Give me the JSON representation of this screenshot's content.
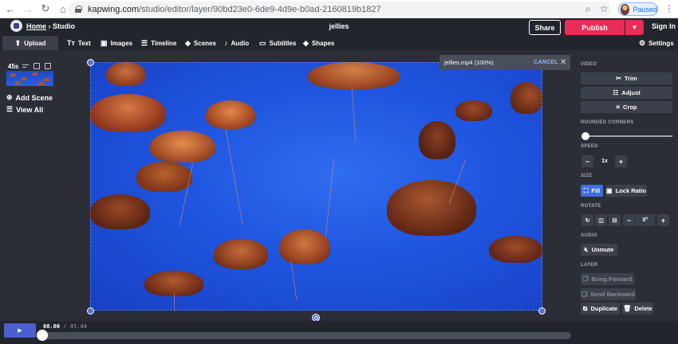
{
  "browser": {
    "url_host": "kapwing.com",
    "url_path": "/studio/editor/layer/90bd23e0-6de9-4d9e-b0ad-2160819b1827",
    "profile_status": "Paused"
  },
  "header": {
    "breadcrumb_home": "Home",
    "breadcrumb_sep": "›",
    "breadcrumb_current": "Studio",
    "project_title": "jellies",
    "share_label": "Share",
    "publish_label": "Publish",
    "signin_label": "Sign In"
  },
  "toolbar": {
    "items": [
      {
        "label": "Upload",
        "icon": "upload-icon"
      },
      {
        "label": "Text",
        "icon": "text-icon"
      },
      {
        "label": "Images",
        "icon": "images-icon"
      },
      {
        "label": "Timeline",
        "icon": "timeline-icon"
      },
      {
        "label": "Scenes",
        "icon": "scenes-icon"
      },
      {
        "label": "Audio",
        "icon": "music-note-icon"
      },
      {
        "label": "Subtitles",
        "icon": "subtitles-icon"
      },
      {
        "label": "Shapes",
        "icon": "shapes-icon"
      }
    ],
    "settings_label": "Settings"
  },
  "scenes": {
    "duration": "45s",
    "add_scene_label": "Add Scene",
    "view_all_label": "View All"
  },
  "toast": {
    "filename": "jellies.mp4 (100%)",
    "cancel_label": "CANCEL"
  },
  "right_panel": {
    "video_heading": "VIDEO",
    "trim_label": "Trim",
    "adjust_label": "Adjust",
    "crop_label": "Crop",
    "rounded_heading": "ROUNDED CORNERS",
    "rounded_value": 0,
    "speed_heading": "SPEED",
    "speed_value": "1x",
    "size_heading": "SIZE",
    "fill_label": "Fill",
    "lock_ratio_label": "Lock Ratio",
    "rotate_heading": "ROTATE",
    "rotate_value": "0°",
    "audio_heading": "AUDIO",
    "unmute_label": "Unmute",
    "layer_heading": "LAYER",
    "bring_forward_label": "Bring Forward",
    "send_backward_label": "Send Backward",
    "duplicate_label": "Duplicate",
    "delete_label": "Delete"
  },
  "timeline": {
    "current_time": "00.00",
    "separator": "/",
    "total_time": "45.44",
    "progress": 0
  },
  "colors": {
    "accent_publish": "#ea2c58",
    "accent_blue": "#3f6fe0",
    "background": "#2b2e36"
  }
}
